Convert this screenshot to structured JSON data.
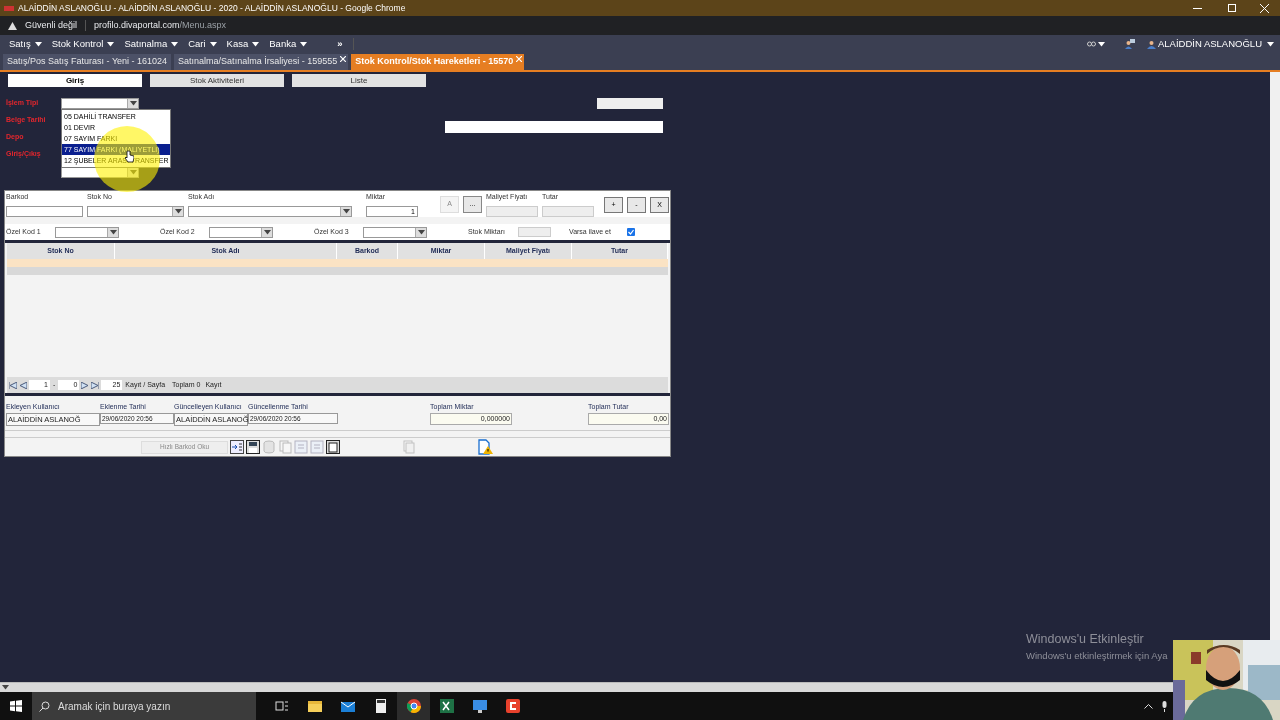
{
  "window": {
    "title": "ALAİDDİN ASLANOĞLU - ALAİDDİN ASLANOĞLU - 2020 - ALAİDDİN ASLANOĞLU - Google Chrome"
  },
  "address_bar": {
    "security": "Güvenli değil",
    "host": "profilo.divaportal.com",
    "path": "/Menu.aspx"
  },
  "menu": [
    "Satış",
    "Stok Kontrol",
    "Satınalma",
    "Cari",
    "Kasa",
    "Banka"
  ],
  "menu_more": "»",
  "user": "ALAİDDİN ASLANOĞLU",
  "doc_tabs": [
    {
      "label": "Satış/Pos Satış Faturası - Yeni - 161024",
      "selected": false,
      "closable": false
    },
    {
      "label": "Satınalma/Satınalma İrsaliyesi - 159555",
      "selected": false,
      "closable": true
    },
    {
      "label": "Stok Kontrol/Stok Hareketleri - 15570",
      "selected": true,
      "closable": true
    }
  ],
  "sub_tabs": [
    {
      "label": "Giriş",
      "selected": true
    },
    {
      "label": "Stok Aktiviteleri",
      "selected": false
    },
    {
      "label": "Liste",
      "selected": false
    }
  ],
  "header_fields": [
    "İşlem Tipi",
    "Belge Tarihi",
    "Depo",
    "Giriş/Çıkış"
  ],
  "dropdown": [
    {
      "label": "05 DAHİLİ TRANSFER",
      "selected": false
    },
    {
      "label": "01 DEVIR",
      "selected": false
    },
    {
      "label": "07 SAYIM FARKI",
      "selected": false
    },
    {
      "label": "77 SAYIM FARKI (MALIYETLI)",
      "selected": true
    },
    {
      "label": "12 ŞUBELER ARASI TRANSFER",
      "selected": false
    }
  ],
  "entry_fields": [
    {
      "label": "Barkod",
      "kind": "text"
    },
    {
      "label": "Stok No",
      "kind": "combo"
    },
    {
      "label": "Stok Adı",
      "kind": "combo"
    },
    {
      "label": "Miktar",
      "kind": "number",
      "value": "1"
    }
  ],
  "entry_buttons": [
    {
      "label": "A",
      "disabled": true
    },
    {
      "label": "...",
      "disabled": false
    }
  ],
  "price_fields": [
    "Maliyet Fiyatı",
    "Tutar"
  ],
  "row_buttons": [
    "+",
    "-",
    "X"
  ],
  "filters": [
    "Özel Kod 1",
    "Özel Kod 2",
    "Özel Kod 3"
  ],
  "stock_qty_label": "Stok Miktarı",
  "add_if_exists": {
    "label": "Varsa ilave et",
    "checked": true
  },
  "table": {
    "columns": [
      "Stok No",
      "Stok Adı",
      "Barkod",
      "Miktar",
      "Maliyet Fiyatı",
      "Tutar"
    ]
  },
  "pager": {
    "page": "1",
    "separator": "-",
    "pages": "0",
    "page_size": "25",
    "per_page_label": "Kayıt / Sayfa",
    "total": "Toplam 0",
    "total_unit": "Kayıt"
  },
  "audit": [
    {
      "label": "Ekleyen Kullanıcı",
      "value": "ALAİDDİN ASLANOĞ"
    },
    {
      "label": "Eklenme Tarihi",
      "value": "29/06/2020 20:56"
    },
    {
      "label": "Güncelleyen Kullanıcı",
      "value": "ALAİDDİN ASLANOĞ"
    },
    {
      "label": "Güncellenme Tarihi",
      "value": "29/06/2020 20:56"
    }
  ],
  "totals": [
    {
      "label": "Toplam Miktar",
      "value": "0,000000"
    },
    {
      "label": "Toplam Tutar",
      "value": "0,00"
    }
  ],
  "quick_barcode": {
    "label": "Hızlı Barkod Oku",
    "disabled": true
  },
  "activation": {
    "title": "Windows'u Etkinleştir",
    "text": "Windows'u etkinleştirmek için Aya"
  },
  "taskbar": {
    "search_placeholder": "Aramak için buraya yazın"
  },
  "webcam": {
    "kind": "picture"
  }
}
